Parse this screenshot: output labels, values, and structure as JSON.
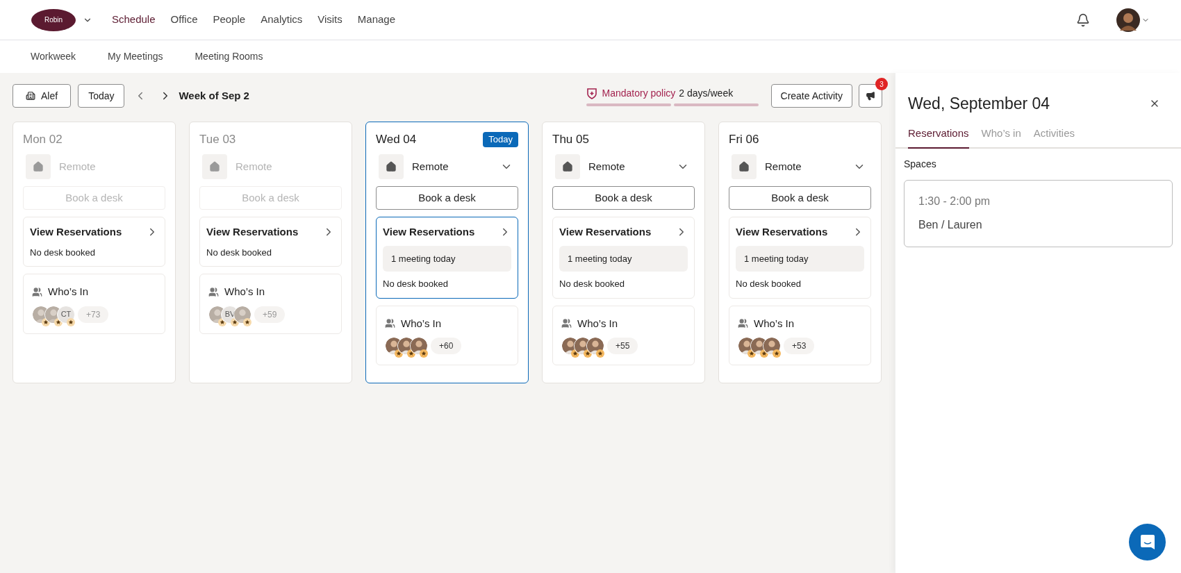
{
  "brand": {
    "logo": "Robin"
  },
  "nav": [
    {
      "label": "Schedule",
      "selected": true
    },
    {
      "label": "Office",
      "selected": false
    },
    {
      "label": "People",
      "selected": false
    },
    {
      "label": "Analytics",
      "selected": false
    },
    {
      "label": "Visits",
      "selected": false
    },
    {
      "label": "Manage",
      "selected": false
    }
  ],
  "subnav": [
    {
      "label": "Workweek"
    },
    {
      "label": "My Meetings"
    },
    {
      "label": "Meeting Rooms"
    }
  ],
  "toolbar": {
    "location": "Alef",
    "today": "Today",
    "week": "Week of Sep 2",
    "policy": {
      "label": "Mandatory policy",
      "value": "2 days/week"
    },
    "create": "Create Activity",
    "notifications": "3"
  },
  "days": [
    {
      "label": "Mon 02",
      "past": true,
      "today": false,
      "selected": false,
      "location": "Remote",
      "book": "Book a desk",
      "reservations": {
        "title": "View Reservations",
        "status": "No desk booked"
      },
      "whos_in": {
        "title": "Who’s In",
        "avatars": [
          {
            "kind": "photo"
          },
          {
            "kind": "photo"
          },
          {
            "kind": "initials",
            "initials": "CT"
          }
        ],
        "more": "+73"
      }
    },
    {
      "label": "Tue 03",
      "past": true,
      "today": false,
      "selected": false,
      "location": "Remote",
      "book": "Book a desk",
      "reservations": {
        "title": "View Reservations",
        "status": "No desk booked"
      },
      "whos_in": {
        "title": "Who’s In",
        "avatars": [
          {
            "kind": "photo"
          },
          {
            "kind": "initials",
            "initials": "BV"
          },
          {
            "kind": "photo"
          }
        ],
        "more": "+59"
      }
    },
    {
      "label": "Wed 04",
      "past": false,
      "today": true,
      "today_label": "Today",
      "selected": true,
      "location": "Remote",
      "book": "Book a desk",
      "reservations": {
        "title": "View Reservations",
        "meeting": "1 meeting today",
        "status": "No desk booked"
      },
      "whos_in": {
        "title": "Who’s In",
        "avatars": [
          {
            "kind": "photo"
          },
          {
            "kind": "photo"
          },
          {
            "kind": "photo"
          }
        ],
        "more": "+60"
      }
    },
    {
      "label": "Thu 05",
      "past": false,
      "today": false,
      "selected": false,
      "location": "Remote",
      "book": "Book a desk",
      "reservations": {
        "title": "View Reservations",
        "meeting": "1 meeting today",
        "status": "No desk booked"
      },
      "whos_in": {
        "title": "Who’s In",
        "avatars": [
          {
            "kind": "photo"
          },
          {
            "kind": "photo"
          },
          {
            "kind": "photo"
          }
        ],
        "more": "+55"
      }
    },
    {
      "label": "Fri 06",
      "past": false,
      "today": false,
      "selected": false,
      "location": "Remote",
      "book": "Book a desk",
      "reservations": {
        "title": "View Reservations",
        "meeting": "1 meeting today",
        "status": "No desk booked"
      },
      "whos_in": {
        "title": "Who’s In",
        "avatars": [
          {
            "kind": "photo"
          },
          {
            "kind": "photo"
          },
          {
            "kind": "photo"
          }
        ],
        "more": "+53"
      }
    }
  ],
  "panel": {
    "title": "Wed, September 04",
    "tabs": [
      {
        "label": "Reservations",
        "selected": true
      },
      {
        "label": "Who’s in",
        "selected": false
      },
      {
        "label": "Activities",
        "selected": false
      }
    ],
    "section": "Spaces",
    "spaces": [
      {
        "time": "1:30 - 2:00 pm",
        "name": "Ben / Lauren"
      }
    ]
  }
}
